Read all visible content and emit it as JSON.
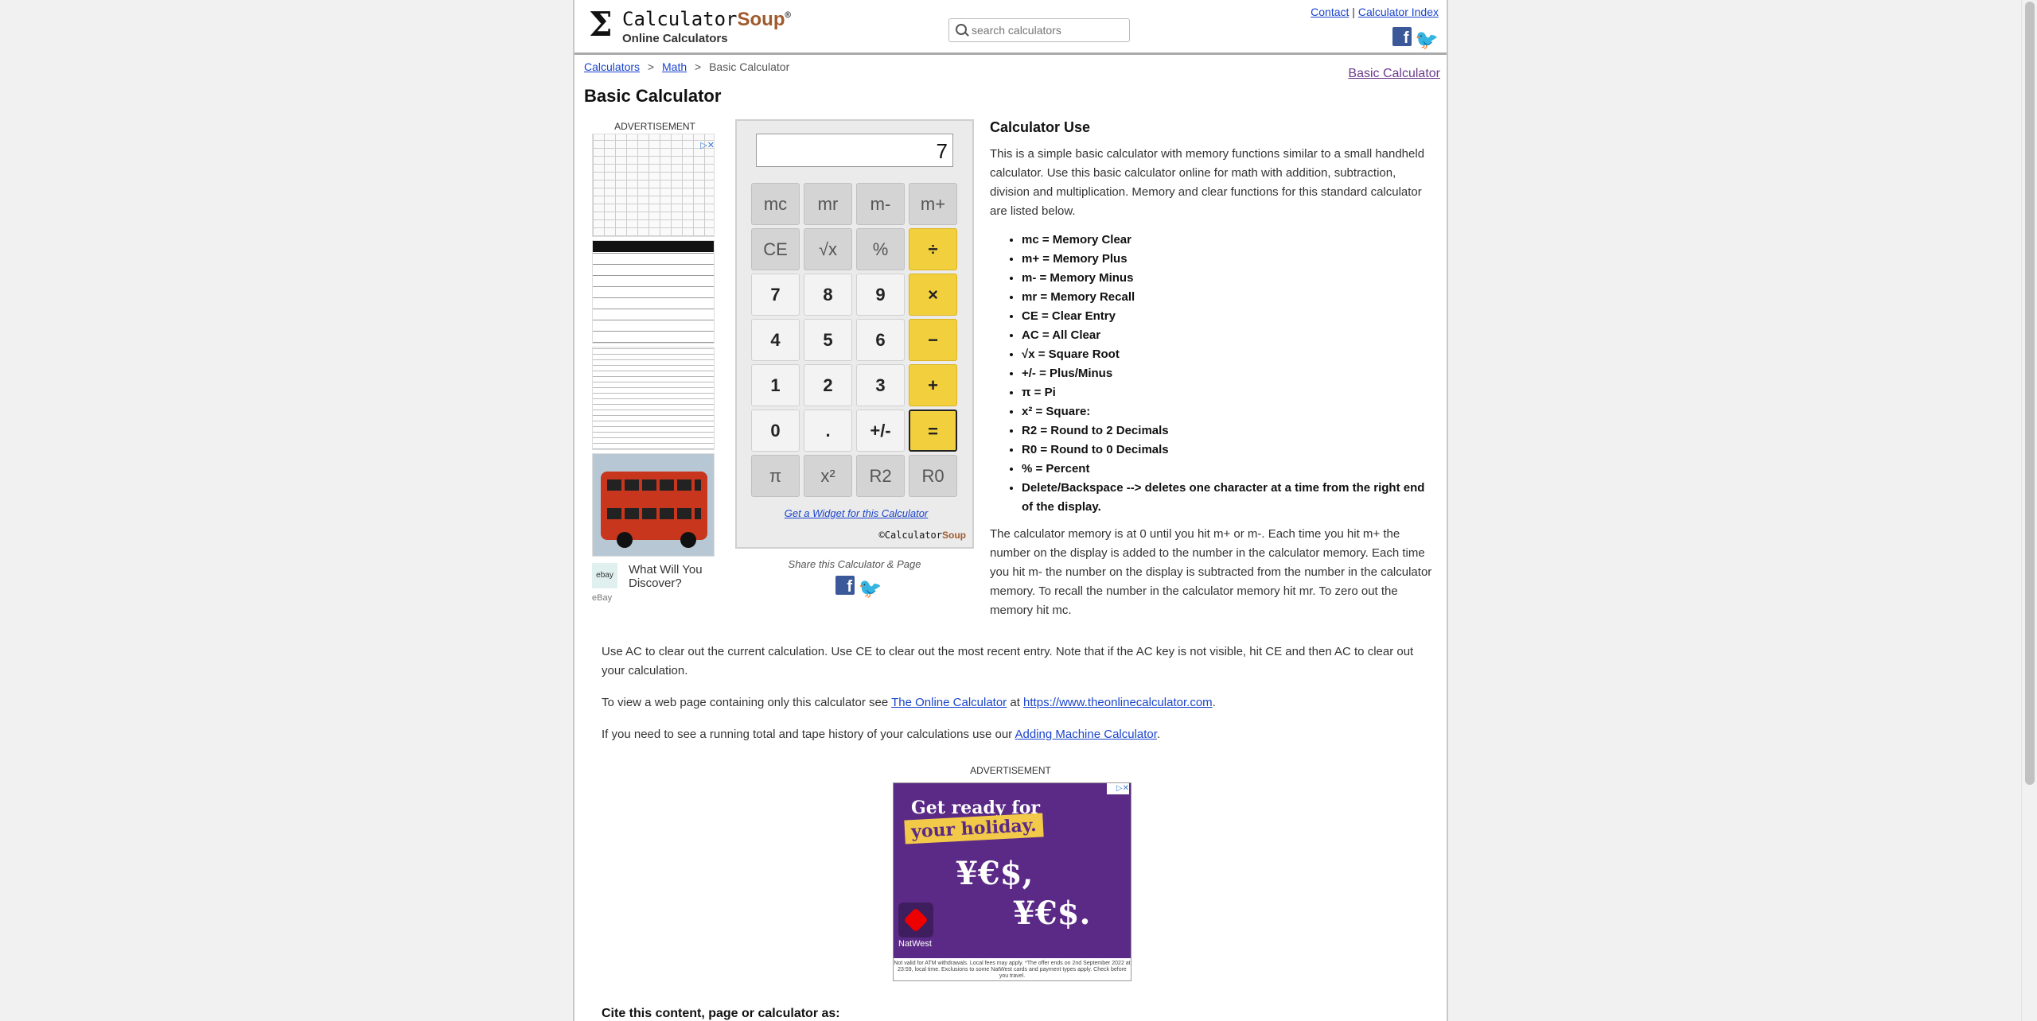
{
  "header": {
    "logo_symbol": "Σ",
    "logo_name": "Calculator",
    "logo_soup": "Soup",
    "logo_reg": "®",
    "logo_tagline": "Online Calculators",
    "search_placeholder": "search calculators",
    "link_contact": "Contact",
    "link_sep": "|",
    "link_index": "Calculator Index",
    "facebook_glyph": "f",
    "twitter_glyph": "🐦"
  },
  "breadcrumb": {
    "items": [
      "Calculators",
      "Math",
      "Basic Calculator"
    ],
    "sep": ">"
  },
  "right_link": "Basic Calculator",
  "page_title": "Basic Calculator",
  "ad_left": {
    "label": "ADVERTISEMENT",
    "close": "▷✕",
    "caption": "What Will You Discover?",
    "source": "eBay",
    "logo": "ebay"
  },
  "calculator": {
    "display_value": "7",
    "keys": {
      "mc": "mc",
      "mr": "mr",
      "mminus": "m-",
      "mplus": "m+",
      "ce": "CE",
      "sqrt": "√x",
      "percent": "%",
      "divide": "÷",
      "seven": "7",
      "eight": "8",
      "nine": "9",
      "multiply": "×",
      "four": "4",
      "five": "5",
      "six": "6",
      "minus": "−",
      "one": "1",
      "two": "2",
      "three": "3",
      "plus": "+",
      "zero": "0",
      "dot": ".",
      "plusminus": "+/-",
      "equals": "=",
      "pi": "π",
      "square": "x²",
      "r2": "R2",
      "r0": "R0"
    },
    "widget_link": "Get a Widget for this Calculator",
    "credit_prefix": "©Calculator",
    "credit_soup": "Soup",
    "share_label": "Share this Calculator & Page"
  },
  "calc_use": {
    "heading": "Calculator Use",
    "intro": "This is a simple basic calculator with memory functions similar to a small handheld calculator. Use this basic calculator online for math with addition, subtraction, division and multiplication. Memory and clear functions for this standard calculator are listed below.",
    "list": [
      "mc = Memory Clear",
      "m+ = Memory Plus",
      "m- = Memory Minus",
      "mr = Memory Recall",
      "CE = Clear Entry",
      "AC = All Clear",
      "√x = Square Root",
      "+/- = Plus/Minus",
      "π = Pi",
      "x² = Square:",
      "R2 = Round to 2 Decimals",
      "R0 = Round to 0 Decimals",
      "% = Percent",
      "Delete/Backspace --> deletes one character at a time from the right end of the display."
    ],
    "memory_paragraph": "The calculator memory is at 0 until you hit m+ or m-. Each time you hit m+ the number on the display is added to the number in the calculator memory. Each time you hit m- the number on the display is subtracted from the number in the calculator memory. To recall the number in the calculator memory hit mr. To zero out the memory hit mc."
  },
  "body": {
    "clear_paragraph": "Use AC to clear out the current calculation. Use CE to clear out the most recent entry. Note that if the AC key is not visible, hit CE and then AC to clear out your calculation.",
    "online_prefix": "To view a web page containing only this calculator see ",
    "online_link": "The Online Calculator",
    "online_mid": " at ",
    "online_url": "https://www.theonlinecalculator.com",
    "online_suffix": ".",
    "adding_prefix": "If you need to see a running total and tape history of your calculations use our ",
    "adding_link": "Adding Machine Calculator",
    "adding_suffix": ".",
    "cite": "Cite this content, page or calculator as:"
  },
  "ad_bottom": {
    "label": "ADVERTISEMENT",
    "close": "▷✕",
    "line1": "Get ready for",
    "line2": "your holiday.",
    "line3": "¥€$,",
    "line4": "¥€$.",
    "brand": "NatWest",
    "fine_print": "Not valid for ATM withdrawals. Local fees may apply. *The offer ends on 2nd September 2022 at 23:59, local time. Exclusions to some NatWest cards and payment types apply. Check before you travel."
  }
}
